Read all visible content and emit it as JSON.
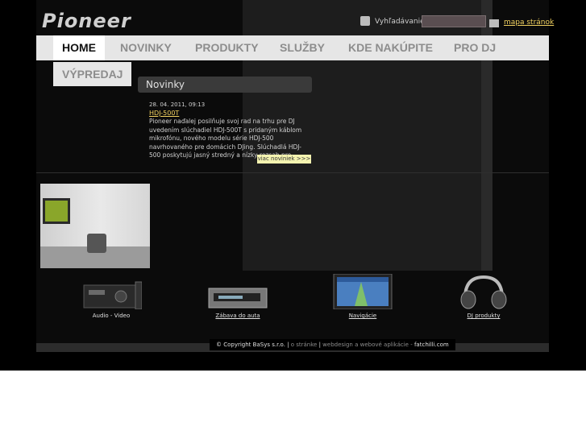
{
  "brand": {
    "logo_text": "Pioneer"
  },
  "header": {
    "search_label": "Vyhľadávanie:",
    "search_value": "",
    "sitemap_label": "mapa stránok"
  },
  "nav": {
    "items": [
      "HOME",
      "NOVINKY",
      "PRODUKTY",
      "SLUŽBY",
      "KDE NAKÚPITE",
      "PRO DJ"
    ],
    "sub_item": "VÝPREDAJ"
  },
  "news": {
    "header": "Novinky",
    "date": "28. 04. 2011, 09:13",
    "title": "HDJ-500T",
    "body": "Pioneer naďalej posilňuje svoj rad na trhu pre DJ uvedením slúchadiel HDJ-500T s pridaným káblom mikrofónu, nového modelu série HDJ-500 navrhovaného pre domácich DJing. Slúchadlá HDJ-500 poskytujú jasný stredný a nízky rozsah pre",
    "more_label": "viac noviniek >>>"
  },
  "products": [
    {
      "label": "Audio - Video",
      "icon": "av-receiver-icon"
    },
    {
      "label": "Zábava do auta",
      "icon": "car-stereo-icon"
    },
    {
      "label": "Navigácie",
      "icon": "navigation-icon"
    },
    {
      "label": "DJ produkty",
      "icon": "headphones-icon"
    }
  ],
  "footer": {
    "copyright": "© Copyright BaSys s.r.o.",
    "about": "o stránke",
    "webdesign": "webdesign a webové aplikácie -",
    "company": "fatchilli.com"
  },
  "colors": {
    "accent_link": "#f0d060",
    "nav_bg": "#e6e6e6",
    "more_bg": "#f4f3b0"
  }
}
